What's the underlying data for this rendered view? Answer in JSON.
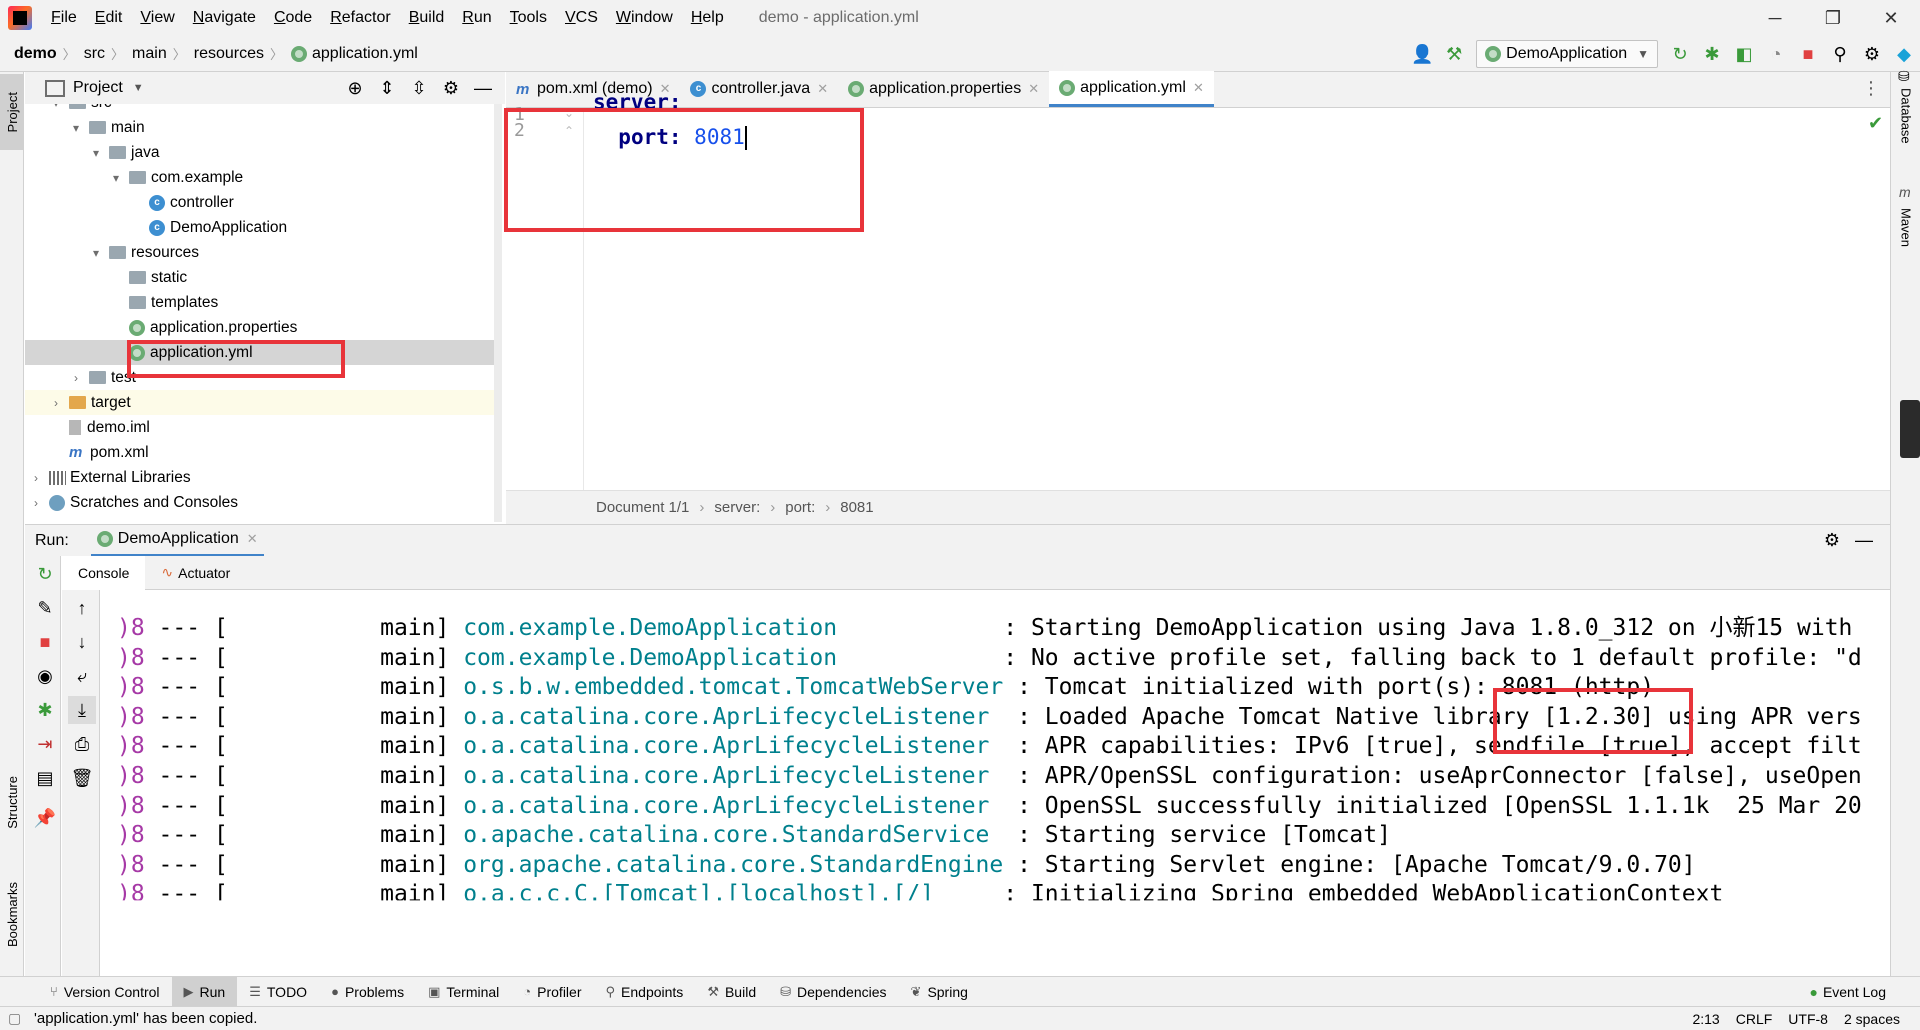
{
  "menubar": {
    "items": [
      {
        "mnemonic": "F",
        "rest": "ile"
      },
      {
        "mnemonic": "E",
        "rest": "dit"
      },
      {
        "mnemonic": "V",
        "rest": "iew"
      },
      {
        "mnemonic": "N",
        "rest": "avigate"
      },
      {
        "mnemonic": "C",
        "rest": "ode"
      },
      {
        "mnemonic": "R",
        "rest": "efactor"
      },
      {
        "mnemonic": "B",
        "rest": "uild"
      },
      {
        "mnemonic": "R",
        "rest": "un"
      },
      {
        "mnemonic": "T",
        "rest": "ools"
      },
      {
        "mnemonic": "V",
        "rest": "CS"
      },
      {
        "mnemonic": "W",
        "rest": "indow"
      },
      {
        "mnemonic": "H",
        "rest": "elp"
      }
    ],
    "window_title": "demo - application.yml",
    "minimize": "─",
    "restore": "❐",
    "close": "✕"
  },
  "navbar": {
    "breadcrumbs": [
      "demo",
      "src",
      "main",
      "resources",
      "application.yml"
    ],
    "run_config": "DemoApplication"
  },
  "left_strip": {
    "project": "Project",
    "structure": "Structure",
    "bookmarks": "Bookmarks"
  },
  "project_panel": {
    "title": "Project",
    "tree": [
      {
        "label": "src",
        "depth": 1,
        "arrow": "▾",
        "icon": "folder"
      },
      {
        "label": "main",
        "depth": 2,
        "arrow": "▾",
        "icon": "folder"
      },
      {
        "label": "java",
        "depth": 3,
        "arrow": "▾",
        "icon": "folder"
      },
      {
        "label": "com.example",
        "depth": 4,
        "arrow": "▾",
        "icon": "folder"
      },
      {
        "label": "controller",
        "depth": 5,
        "arrow": "",
        "icon": "class"
      },
      {
        "label": "DemoApplication",
        "depth": 5,
        "arrow": "",
        "icon": "class"
      },
      {
        "label": "resources",
        "depth": 3,
        "arrow": "▾",
        "icon": "folder"
      },
      {
        "label": "static",
        "depth": 4,
        "arrow": "",
        "icon": "folder"
      },
      {
        "label": "templates",
        "depth": 4,
        "arrow": "",
        "icon": "folder"
      },
      {
        "label": "application.properties",
        "depth": 4,
        "arrow": "",
        "icon": "yml"
      },
      {
        "label": "application.yml",
        "depth": 4,
        "arrow": "",
        "icon": "yml",
        "selected": true
      },
      {
        "label": "test",
        "depth": 2,
        "arrow": "›",
        "icon": "folder"
      },
      {
        "label": "target",
        "depth": 1,
        "arrow": "›",
        "icon": "folder-orange",
        "highlight": true
      },
      {
        "label": "demo.iml",
        "depth": 1,
        "arrow": "",
        "icon": "file"
      },
      {
        "label": "pom.xml",
        "depth": 1,
        "arrow": "",
        "icon": "maven"
      },
      {
        "label": "External Libraries",
        "depth": 0,
        "arrow": "›",
        "icon": "lib"
      },
      {
        "label": "Scratches and Consoles",
        "depth": 0,
        "arrow": "›",
        "icon": "scratch"
      }
    ]
  },
  "editor": {
    "tabs": [
      {
        "label": "pom.xml (demo)",
        "icon": "maven"
      },
      {
        "label": "controller.java",
        "icon": "class"
      },
      {
        "label": "application.properties",
        "icon": "yml"
      },
      {
        "label": "application.yml",
        "icon": "yml",
        "active": true
      }
    ],
    "line_numbers": [
      "1",
      "2"
    ],
    "line1_key": "server:",
    "line2_key": "port:",
    "line2_value": "8081",
    "breadcrumb": [
      "Document 1/1",
      "server:",
      "port:",
      "8081"
    ]
  },
  "right_strip": {
    "database": "Database",
    "maven": "Maven"
  },
  "run_panel": {
    "label": "Run:",
    "tab": "DemoApplication",
    "console_tabs": [
      "Console",
      "Actuator"
    ],
    "lines": [
      {
        "pid": ")8",
        "sep": " --- [",
        "thread": "           main]",
        "logger": " com.example.DemoApplication           ",
        "msg": " : Starting DemoApplication using Java 1.8.0_312 on 小新15 with"
      },
      {
        "pid": ")8",
        "sep": " --- [",
        "thread": "           main]",
        "logger": " com.example.DemoApplication           ",
        "msg": " : No active profile set, falling back to 1 default profile: \"d"
      },
      {
        "pid": ")8",
        "sep": " --- [",
        "thread": "           main]",
        "logger": " o.s.b.w.embedded.tomcat.TomcatWebServer",
        "msg": " : Tomcat initialized with port(s): 8081 (http)"
      },
      {
        "pid": ")8",
        "sep": " --- [",
        "thread": "           main]",
        "logger": " o.a.catalina.core.AprLifecycleListener ",
        "msg": " : Loaded Apache Tomcat Native library [1.2.30] using APR vers"
      },
      {
        "pid": ")8",
        "sep": " --- [",
        "thread": "           main]",
        "logger": " o.a.catalina.core.AprLifecycleListener ",
        "msg": " : APR capabilities: IPv6 [true], sendfile [true], accept filt"
      },
      {
        "pid": ")8",
        "sep": " --- [",
        "thread": "           main]",
        "logger": " o.a.catalina.core.AprLifecycleListener ",
        "msg": " : APR/OpenSSL configuration: useAprConnector [false], useOpen"
      },
      {
        "pid": ")8",
        "sep": " --- [",
        "thread": "           main]",
        "logger": " o.a.catalina.core.AprLifecycleListener ",
        "msg": " : OpenSSL successfully initialized [OpenSSL 1.1.1k  25 Mar 20"
      },
      {
        "pid": ")8",
        "sep": " --- [",
        "thread": "           main]",
        "logger": " o.apache.catalina.core.StandardService ",
        "msg": " : Starting service [Tomcat]"
      },
      {
        "pid": ")8",
        "sep": " --- [",
        "thread": "           main]",
        "logger": " org.apache.catalina.core.StandardEngine",
        "msg": " : Starting Servlet engine: [Apache Tomcat/9.0.70]"
      },
      {
        "pid": ")8",
        "sep": " --- [",
        "thread": "           main]",
        "logger": " o.a.c.c.C.[Tomcat].[localhost].[/]    ",
        "msg": " : Initializing Spring embedded WebApplicationContext"
      }
    ]
  },
  "bottom_tabs": [
    {
      "label": "Version Control",
      "icon": "⑂"
    },
    {
      "label": "Run",
      "icon": "▶",
      "active": true
    },
    {
      "label": "TODO",
      "icon": "☰"
    },
    {
      "label": "Problems",
      "icon": "●"
    },
    {
      "label": "Terminal",
      "icon": "▣"
    },
    {
      "label": "Profiler",
      "icon": "◔"
    },
    {
      "label": "Endpoints",
      "icon": "⚲"
    },
    {
      "label": "Build",
      "icon": "⚒"
    },
    {
      "label": "Dependencies",
      "icon": "⛁"
    },
    {
      "label": "Spring",
      "icon": "❦"
    }
  ],
  "event_log": "Event Log",
  "status_bar": {
    "message": "'application.yml' has been copied.",
    "position": "2:13",
    "line_sep": "CRLF",
    "encoding": "UTF-8",
    "indent": "2 spaces"
  },
  "colors": {
    "annotation_red": "#e8343a",
    "accent_blue": "#4083c9",
    "yaml_key": "#000080",
    "number": "#1750eb",
    "logger_teal": "#00808d"
  }
}
